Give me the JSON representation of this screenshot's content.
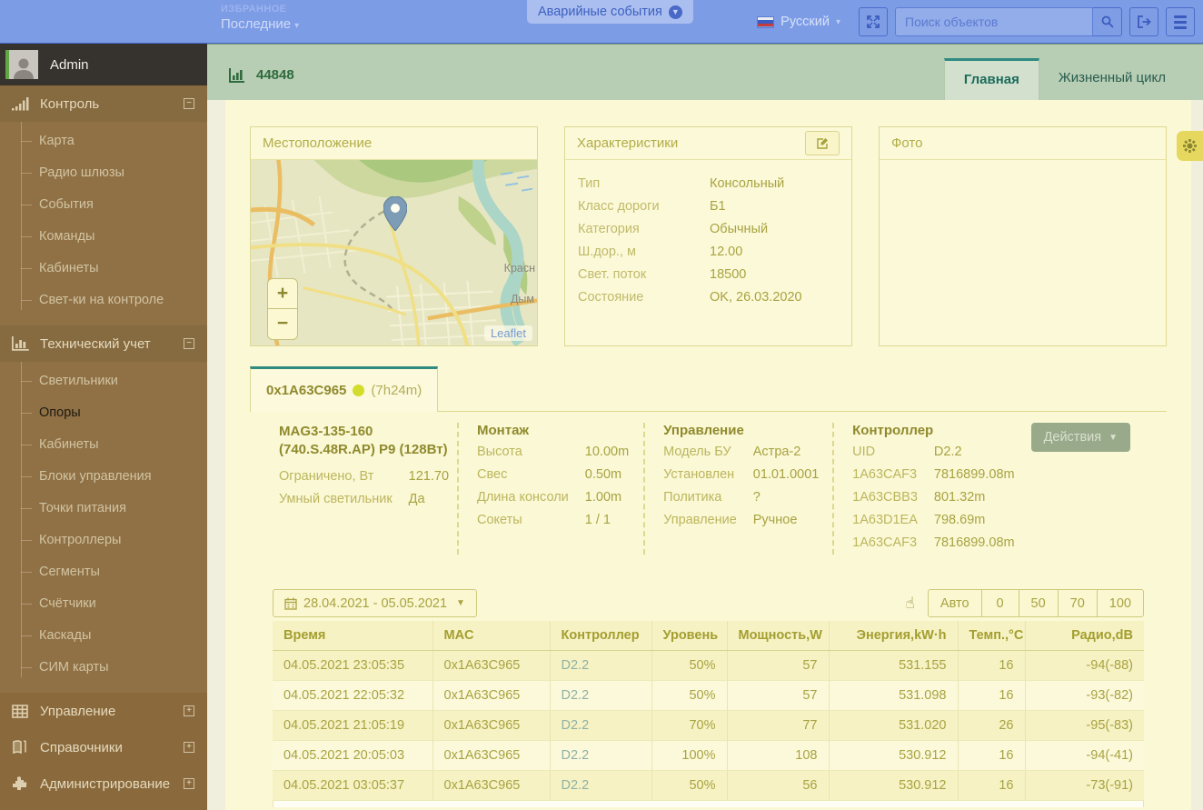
{
  "colors": {
    "topbarBg": "#7d9ce6",
    "sidebarBg": "#8a6a3c",
    "bandBg": "#b7cdb4",
    "cardBg": "#fbf8d5",
    "panelBorder": "#ddd893",
    "teal": "#2f8a80",
    "titleGreen": "#2f6b3c",
    "actionsBg": "#99aa8b",
    "gearBg": "#e6d75f"
  },
  "topbar": {
    "favorites_label": "ИЗБРАННОЕ",
    "favorites_value": "Последние",
    "emergency_button": "Аварийные события",
    "language": "Русский",
    "search_placeholder": "Поиск объектов"
  },
  "sidebar": {
    "user": "Admin",
    "sections": [
      {
        "label": "Контроль",
        "icon": "signal-bars-icon",
        "expanded": true,
        "items": [
          "Карта",
          "Радио шлюзы",
          "События",
          "Команды",
          "Кабинеты",
          "Свет-ки на контроле"
        ]
      },
      {
        "label": "Технический учет",
        "icon": "bar-chart-icon",
        "expanded": true,
        "active_item": "Опоры",
        "items": [
          "Светильники",
          "Опоры",
          "Кабинеты",
          "Блоки управления",
          "Точки питания",
          "Контроллеры",
          "Сегменты",
          "Счётчики",
          "Каскады",
          "СИМ карты"
        ]
      },
      {
        "label": "Управление",
        "icon": "table-icon",
        "expanded": false,
        "items": []
      },
      {
        "label": "Справочники",
        "icon": "book-icon",
        "expanded": false,
        "items": []
      },
      {
        "label": "Администрирование",
        "icon": "puzzle-icon",
        "expanded": false,
        "items": []
      }
    ]
  },
  "header": {
    "title": "44848",
    "tabs": [
      {
        "label": "Главная",
        "active": true
      },
      {
        "label": "Жизненный цикл",
        "active": false
      }
    ]
  },
  "panels": {
    "location": {
      "title": "Местоположение",
      "map": {
        "zoom_in": "+",
        "zoom_out": "−",
        "attribution": "Leaflet",
        "labels": [
          "Красн",
          "Дым"
        ]
      }
    },
    "characteristics": {
      "title": "Характеристики",
      "rows": [
        [
          "Тип",
          "Консольный"
        ],
        [
          "Класс дороги",
          "Б1"
        ],
        [
          "Категория",
          "Обычный"
        ],
        [
          "Ш.дор., м",
          "12.00"
        ],
        [
          "Свет. поток",
          "18500"
        ],
        [
          "Состояние",
          "OK, 26.03.2020"
        ]
      ]
    },
    "photo": {
      "title": "Фото"
    }
  },
  "device": {
    "tab": {
      "mac": "0x1A63C965",
      "uptime": "(7h24m)"
    },
    "model_title": "MAG3-135-160 (740.S.48R.AP) P9 (128Вт)",
    "model_rows": [
      [
        "Ограничено, Вт",
        "121.70"
      ],
      [
        "Умный светильник",
        "Да"
      ]
    ],
    "mount": {
      "title": "Монтаж",
      "rows": [
        [
          "Высота",
          "10.00m"
        ],
        [
          "Свес",
          "0.50m"
        ],
        [
          "Длина консоли",
          "1.00m"
        ],
        [
          "Сокеты",
          "1 / 1"
        ]
      ]
    },
    "control": {
      "title": "Управление",
      "rows": [
        [
          "Модель БУ",
          "Астра-2"
        ],
        [
          "Установлен",
          "01.01.0001"
        ],
        [
          "Политика",
          "?"
        ],
        [
          "Управление",
          "Ручное"
        ]
      ]
    },
    "controller": {
      "title": "Контроллер",
      "rows": [
        [
          "UID",
          "D2.2"
        ],
        [
          "1A63CAF3",
          "7816899.08m"
        ],
        [
          "1A63CBB3",
          "801.32m"
        ],
        [
          "1A63D1EA",
          "798.69m"
        ],
        [
          "1A63CAF3",
          "7816899.08m"
        ]
      ]
    },
    "actions_button": "Действия"
  },
  "toolbar": {
    "date_range": "28.04.2021 - 05.05.2021",
    "level_buttons": [
      "Авто",
      "0",
      "50",
      "70",
      "100"
    ]
  },
  "table": {
    "columns": [
      "Время",
      "MAC",
      "Контроллер",
      "Уровень",
      "Мощность,W",
      "Энергия,kW·h",
      "Темп.,°C",
      "Радио,dB"
    ],
    "rows": [
      [
        "04.05.2021 23:05:35",
        "0x1A63C965",
        "D2.2",
        "50%",
        "57",
        "531.155",
        "16",
        "-94(-88)"
      ],
      [
        "04.05.2021 22:05:32",
        "0x1A63C965",
        "D2.2",
        "50%",
        "57",
        "531.098",
        "16",
        "-93(-82)"
      ],
      [
        "04.05.2021 21:05:19",
        "0x1A63C965",
        "D2.2",
        "70%",
        "77",
        "531.020",
        "26",
        "-95(-83)"
      ],
      [
        "04.05.2021 20:05:03",
        "0x1A63C965",
        "D2.2",
        "100%",
        "108",
        "530.912",
        "16",
        "-94(-41)"
      ],
      [
        "04.05.2021 03:05:37",
        "0x1A63C965",
        "D2.2",
        "50%",
        "56",
        "530.912",
        "16",
        "-73(-91)"
      ]
    ]
  },
  "icons": [
    "chevron-down-icon",
    "circle-arrow-down-icon",
    "flag-russia-icon",
    "fullscreen-icon",
    "search-icon",
    "logout-icon",
    "menu-icon",
    "signal-bars-icon",
    "bar-chart-icon",
    "table-icon",
    "book-icon",
    "puzzle-icon",
    "collapse-icon",
    "expand-icon",
    "chart-icon",
    "edit-icon",
    "map-marker-icon",
    "zoom-in-icon",
    "zoom-out-icon",
    "calendar-icon",
    "pointer-hand-icon",
    "gear-icon"
  ]
}
